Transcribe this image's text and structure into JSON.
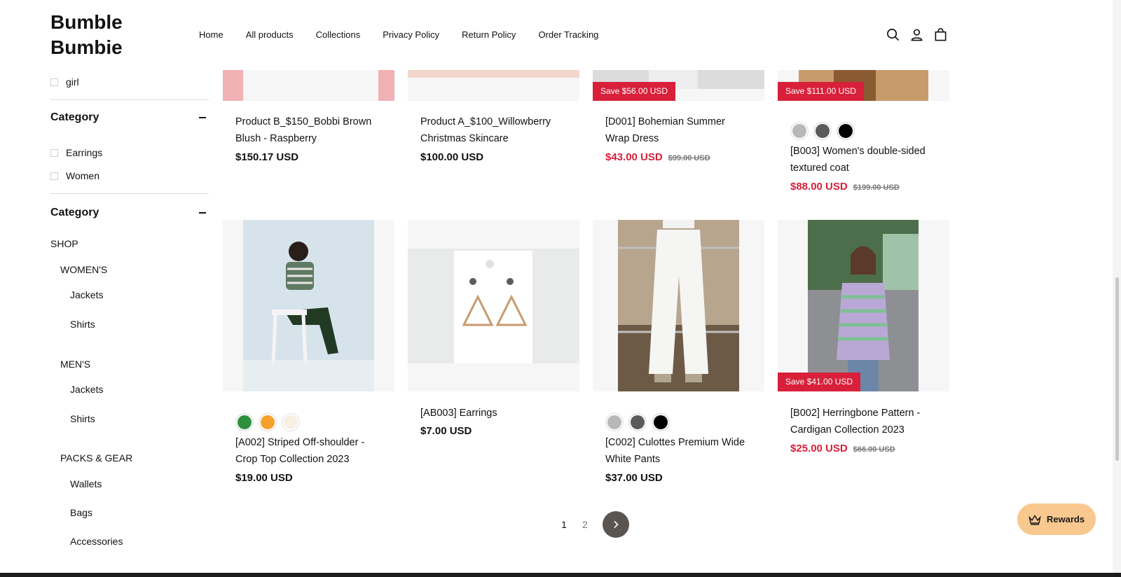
{
  "brand": {
    "line1": "Bumble",
    "line2": "Bumbie"
  },
  "nav": [
    {
      "label": "Home"
    },
    {
      "label": "All products"
    },
    {
      "label": "Collections"
    },
    {
      "label": "Privacy Policy"
    },
    {
      "label": "Return Policy"
    },
    {
      "label": "Order Tracking"
    }
  ],
  "filters": {
    "top_option": "girl",
    "category1": {
      "title": "Category",
      "options": [
        "Earrings",
        "Women"
      ]
    },
    "category2": {
      "title": "Category"
    },
    "tree": {
      "shop": "SHOP",
      "womens": "WOMEN'S",
      "womens_jackets": "Jackets",
      "womens_shirts": "Shirts",
      "mens": "MEN'S",
      "mens_jackets": "Jackets",
      "mens_shirts": "Shirts",
      "packs": "PACKS & GEAR",
      "wallets": "Wallets",
      "bags": "Bags",
      "accessories": "Accessories"
    }
  },
  "products_top": [
    {
      "title": "Product B_$150_Bobbi Brown Blush - Raspberry",
      "price": "$150.17 USD"
    },
    {
      "title": "Product A_$100_Willowberry Christmas Skincare",
      "price": "$100.00 USD"
    },
    {
      "title": "[D001] Bohemian Summer Wrap Dress",
      "price": "$43.00 USD",
      "compare": "$99.00 USD",
      "badge": "Save $56.00 USD"
    },
    {
      "title": "[B003] Women's double-sided textured coat",
      "price": "$88.00 USD",
      "compare": "$199.00 USD",
      "badge": "Save $111.00 USD",
      "swatches": [
        "#b8b8b8",
        "#5a5a5a",
        "#000000"
      ]
    }
  ],
  "products_bottom": [
    {
      "title": "[A002] Striped Off-shoulder - Crop Top Collection 2023",
      "price": "$19.00 USD",
      "swatches": [
        "#2e8f3c",
        "#f5a12a",
        "#f7efe4"
      ]
    },
    {
      "title": "[AB003] Earrings",
      "price": "$7.00 USD"
    },
    {
      "title": "[C002] Culottes Premium Wide White Pants",
      "price": "$37.00 USD",
      "swatches": [
        "#b8b8b8",
        "#5a5a5a",
        "#000000"
      ]
    },
    {
      "title": "[B002] Herringbone Pattern - Cardigan Collection 2023",
      "price": "$25.00 USD",
      "compare": "$66.00 USD",
      "badge": "Save $41.00 USD"
    }
  ],
  "pagination": {
    "page1": "1",
    "page2": "2"
  },
  "rewards": {
    "label": "Rewards"
  },
  "colors": {
    "sale": "#d8203a",
    "rewards_bg": "#f8c88f",
    "next_btn": "#5c5450"
  }
}
